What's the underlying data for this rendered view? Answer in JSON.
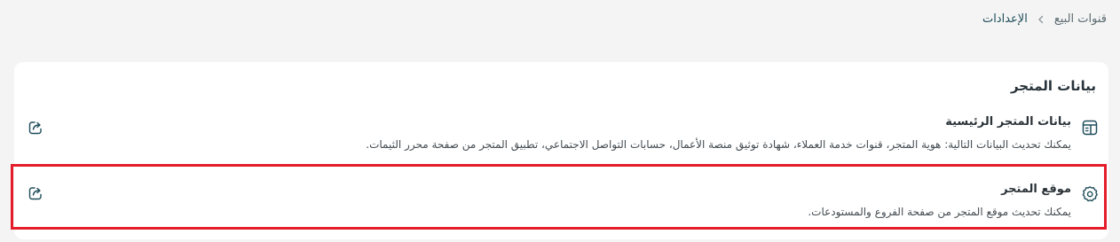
{
  "breadcrumb": {
    "parent": "قنوات البيع",
    "current": "الإعدادات"
  },
  "card": {
    "title": "بيانات المتجر",
    "rows": [
      {
        "title": "بيانات المتجر الرئيسية",
        "description": "يمكنك تحديث البيانات التالية: هوية المتجر، قنوات خدمة العملاء، شهادة توثيق منصة الأعمال، حسابات التواصل الاجتماعي، تطبيق المتجر من صفحة محرر الثيمات.",
        "icon": "store-data-icon"
      },
      {
        "title": "موقع المتجر",
        "description": "يمكنك تحديث موقع المتجر من صفحة الفروع والمستودعات.",
        "icon": "gear-icon"
      }
    ]
  },
  "colors": {
    "accent": "#1f4d5a",
    "highlight": "#e51c2a",
    "background": "#f4f4f4"
  }
}
